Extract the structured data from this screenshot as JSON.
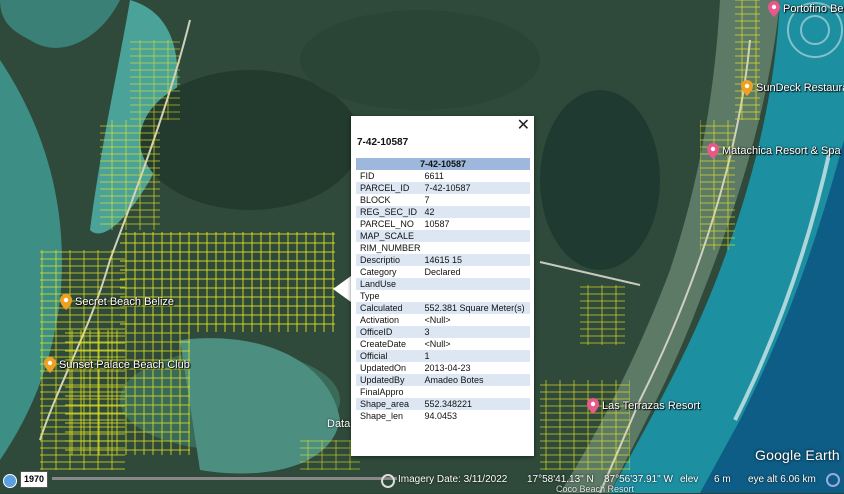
{
  "places": [
    {
      "name": "Portofino Beac",
      "color": "#e8588a"
    },
    {
      "name": "SunDeck Restauran",
      "color": "#f0a020"
    },
    {
      "name": "Matachica Resort & Spa",
      "color": "#e8588a"
    },
    {
      "name": "Secret Beach Belize",
      "color": "#f0a020"
    },
    {
      "name": "Sunset Palace Beach Club",
      "color": "#f0a020"
    },
    {
      "name": "Las Terrazas Resort",
      "color": "#e8588a"
    }
  ],
  "map_text": {
    "data_label": "Data"
  },
  "popup": {
    "title": "7-42-10587",
    "header": "7-42-10587",
    "close": "✕",
    "rows": [
      {
        "key": "FID",
        "value": "6611"
      },
      {
        "key": "PARCEL_ID",
        "value": "7-42-10587"
      },
      {
        "key": "BLOCK",
        "value": "7"
      },
      {
        "key": "REG_SEC_ID",
        "value": "42"
      },
      {
        "key": "PARCEL_NO",
        "value": "10587"
      },
      {
        "key": "MAP_SCALE",
        "value": ""
      },
      {
        "key": "RIM_NUMBER",
        "value": ""
      },
      {
        "key": "Descriptio",
        "value": "14615 15"
      },
      {
        "key": "Category",
        "value": "Declared"
      },
      {
        "key": "LandUse",
        "value": ""
      },
      {
        "key": "Type",
        "value": ""
      },
      {
        "key": "Calculated",
        "value": "552.381 Square Meter(s)"
      },
      {
        "key": "Activation",
        "value": "<Null>"
      },
      {
        "key": "OfficeID",
        "value": "3"
      },
      {
        "key": "CreateDate",
        "value": "<Null>"
      },
      {
        "key": "Official",
        "value": "1"
      },
      {
        "key": "UpdatedOn",
        "value": "2013-04-23"
      },
      {
        "key": "UpdatedBy",
        "value": "Amadeo Botes"
      },
      {
        "key": "FinalAppro",
        "value": ""
      },
      {
        "key": "Shape_area",
        "value": "552.348221"
      },
      {
        "key": "Shape_len",
        "value": "94.0453"
      }
    ]
  },
  "statusbar": {
    "year": "1970",
    "imagery_date": "Imagery Date: 3/11/2022",
    "lat": "17°58'41.13\" N",
    "lon": "87°56'37.91\" W",
    "elev_label": "elev",
    "elev_value": "6 m",
    "eye_alt": "eye alt  6.06 km",
    "hidden_place": "Coco Beach Resort"
  },
  "branding": {
    "logo": "Google Earth"
  },
  "colors": {
    "parcel_lines": "#e8e820",
    "popup_header": "#9db8dc",
    "row_alt": "#dde7f3"
  }
}
